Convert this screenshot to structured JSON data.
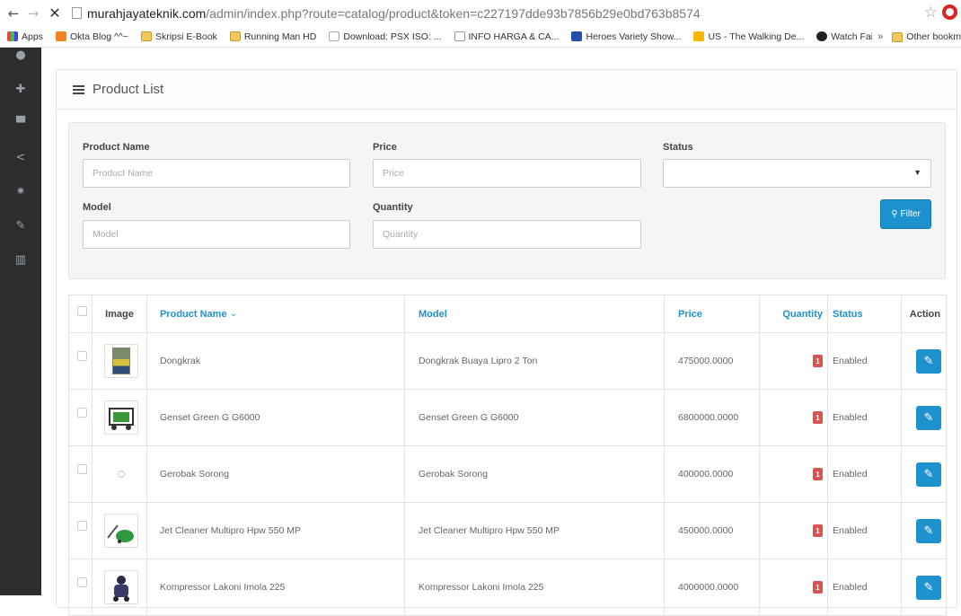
{
  "browser": {
    "url_domain": "murahjayateknik.com",
    "url_path": "/admin/index.php?route=catalog/product&token=c227197dde93b7856b29e0bd763b8574",
    "bookmarks": [
      "Apps",
      "Okta Blog ^^~",
      "Skripsi E-Book",
      "Running Man HD",
      "Download: PSX ISO: ...",
      "INFO HARGA & CA...",
      "Heroes Variety Show...",
      "US - The Walking De...",
      "Watch Fairy Tail Epis..."
    ],
    "other_bookmarks": "Other bookm",
    "chevron": "»"
  },
  "panel": {
    "title": "Product List"
  },
  "filter": {
    "product_name_label": "Product Name",
    "product_name_placeholder": "Product Name",
    "price_label": "Price",
    "price_placeholder": "Price",
    "status_label": "Status",
    "status_value": "",
    "model_label": "Model",
    "model_placeholder": "Model",
    "quantity_label": "Quantity",
    "quantity_placeholder": "Quantity",
    "button_label": "Filter"
  },
  "table": {
    "headers": {
      "image": "Image",
      "name": "Product Name",
      "name_sort": "⌄",
      "model": "Model",
      "price": "Price",
      "quantity": "Quantity",
      "status": "Status",
      "action": "Action"
    },
    "rows": [
      {
        "name": "Dongkrak",
        "model": "Dongkrak Buaya Lipro 2 Ton",
        "price": "475000.0000",
        "quantity": "1",
        "status": "Enabled",
        "image": "jack-thumb"
      },
      {
        "name": "Genset Green G G6000",
        "model": "Genset Green G G6000",
        "price": "6800000.0000",
        "quantity": "1",
        "status": "Enabled",
        "image": "generator-thumb"
      },
      {
        "name": "Gerobak Sorong",
        "model": "Gerobak Sorong",
        "price": "400000.0000",
        "quantity": "1",
        "status": "Enabled",
        "image": "no-image"
      },
      {
        "name": "Jet Cleaner Multipro Hpw 550 MP",
        "model": "Jet Cleaner Multipro Hpw 550 MP",
        "price": "450000.0000",
        "quantity": "1",
        "status": "Enabled",
        "image": "jet-cleaner-thumb"
      },
      {
        "name": "Kompressor Lakoni Imola 225",
        "model": "Kompressor Lakoni Imola 225",
        "price": "4000000.0000",
        "quantity": "1",
        "status": "Enabled",
        "image": "compressor-thumb"
      }
    ]
  },
  "colors": {
    "accent": "#1e91cf",
    "sidebar": "#2b2d2f",
    "badge": "#d9534f"
  }
}
